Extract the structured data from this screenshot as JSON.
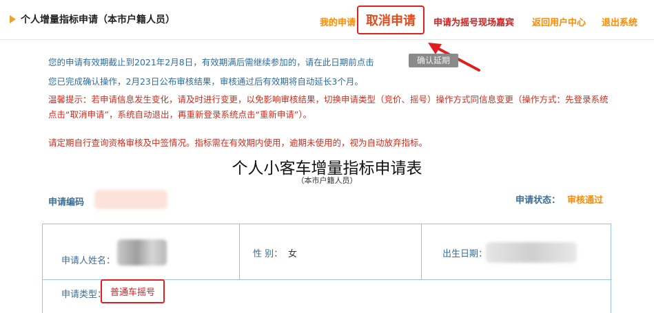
{
  "header": {
    "title": "个人增量指标申请（本市户籍人员）",
    "nav": {
      "my_application": "我的申请",
      "cancel_application": "取消申请",
      "lottery_guest": "申请为摇号现场嘉宾",
      "back_user_center": "返回用户中心",
      "exit_system": "退出系统"
    }
  },
  "notices": {
    "validity": "您的申请有效期截止到2021年2月8日，有效期满后需继续参加的，请在此日期前点击",
    "confirm_button": "确认延期",
    "confirmed": "您已完成确认操作，2月23日公布审核结果，审核通过后有效期将自动延长3个月。",
    "tip": "温馨提示：若申请信息发生变化，请及时进行变更，以免影响审核结果，切换申请类型（竞价、摇号）操作方式同信息变更（操作方式：先登录系统点击“取消申请”，系统自动退出，再重新登录系统点击“重新申请”）。",
    "reminder": "请定期自行查询资格审核及中签情况。指标需在有效期内使用，逾期未使用的，视为自动放弃指标。"
  },
  "form": {
    "title": "个人小客车增量指标申请表",
    "subtitle": "（本市户籍人员）",
    "code_label": "申请编码",
    "status_label": "申请状态：",
    "status_value": "审核通过",
    "applicant_name_label": "申请人姓名：",
    "gender_label": "性 别：",
    "gender_value": "女",
    "birth_label": "出生日期：",
    "type_label": "申请类型：",
    "type_value": "普通车摇号"
  },
  "colors": {
    "accent_orange": "#ff8a00",
    "highlight_red": "#e01e1e",
    "info_blue": "#2e6d9e",
    "warn_red": "#d42a1c"
  }
}
